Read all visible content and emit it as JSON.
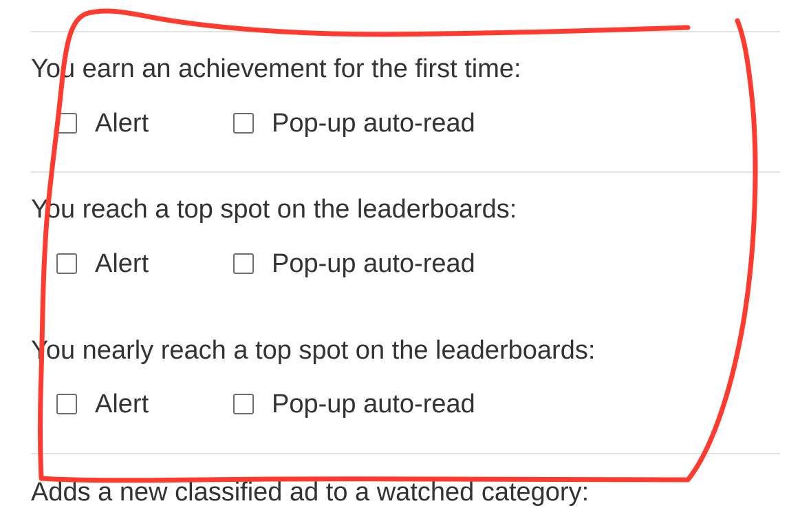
{
  "sections": [
    {
      "question": "You earn an achievement for the first time:",
      "options": [
        "Alert",
        "Pop-up auto-read"
      ]
    },
    {
      "question": "You reach a top spot on the leaderboards:",
      "options": [
        "Alert",
        "Pop-up auto-read"
      ]
    },
    {
      "question": "You nearly reach a top spot on the leaderboards:",
      "options": [
        "Alert",
        "Pop-up auto-read"
      ]
    },
    {
      "question": "Adds a new classified ad to a watched category:"
    }
  ],
  "colors": {
    "annotation": "#ff3b30",
    "text": "#333333",
    "divider": "#e2e2e2",
    "checkbox_border": "#6e6e6e"
  }
}
